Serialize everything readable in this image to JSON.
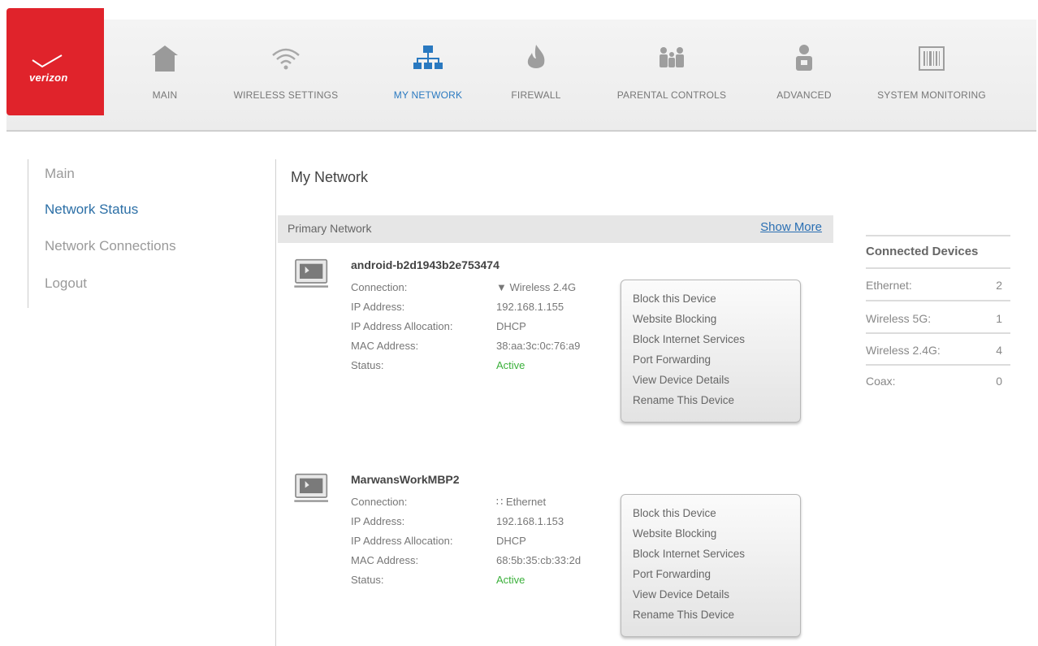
{
  "brand": {
    "logo_text": "verizon",
    "color": "#e0232b"
  },
  "nav": [
    {
      "label": "MAIN",
      "icon": "home-icon"
    },
    {
      "label": "WIRELESS SETTINGS",
      "icon": "wifi-icon"
    },
    {
      "label": "MY NETWORK",
      "icon": "network-icon",
      "active": true
    },
    {
      "label": "FIREWALL",
      "icon": "fire-icon"
    },
    {
      "label": "PARENTAL CONTROLS",
      "icon": "family-icon"
    },
    {
      "label": "ADVANCED",
      "icon": "person-icon"
    },
    {
      "label": "SYSTEM MONITORING",
      "icon": "barcode-icon"
    }
  ],
  "sidebar": {
    "items": [
      {
        "label": "Main"
      },
      {
        "label": "Network Status",
        "active": true
      },
      {
        "label": "Network Connections"
      },
      {
        "label": "Logout"
      }
    ]
  },
  "main": {
    "title": "My Network",
    "section_title": "Primary Network",
    "show_more": "Show More",
    "field_labels": {
      "connection": "Connection:",
      "ip": "IP Address:",
      "allocation": "IP Address Allocation:",
      "mac": "MAC Address:",
      "status": "Status:"
    },
    "devices": [
      {
        "name": "android-b2d1943b2e753474",
        "connection": "Wireless 2.4G",
        "connection_icon": "wifi-icon",
        "ip": "192.168.1.155",
        "allocation": "DHCP",
        "mac": "38:aa:3c:0c:76:a9",
        "status": "Active"
      },
      {
        "name": "MarwansWorkMBP2",
        "connection": "Ethernet",
        "connection_icon": "ethernet-icon",
        "ip": "192.168.1.153",
        "allocation": "DHCP",
        "mac": "68:5b:35:cb:33:2d",
        "status": "Active"
      }
    ],
    "actions": [
      "Block this Device",
      "Website Blocking",
      "Block Internet Services",
      "Port Forwarding",
      "View Device Details",
      "Rename This Device"
    ]
  },
  "connected_devices": {
    "title": "Connected Devices",
    "rows": [
      {
        "label": "Ethernet:",
        "count": "2"
      },
      {
        "label": "Wireless 5G:",
        "count": "1"
      },
      {
        "label": "Wireless 2.4G:",
        "count": "4"
      },
      {
        "label": "Coax:",
        "count": "0"
      }
    ]
  },
  "colors": {
    "active_nav": "#2a79c0",
    "status_active": "#3bb03b",
    "link": "#2a6fb3"
  }
}
